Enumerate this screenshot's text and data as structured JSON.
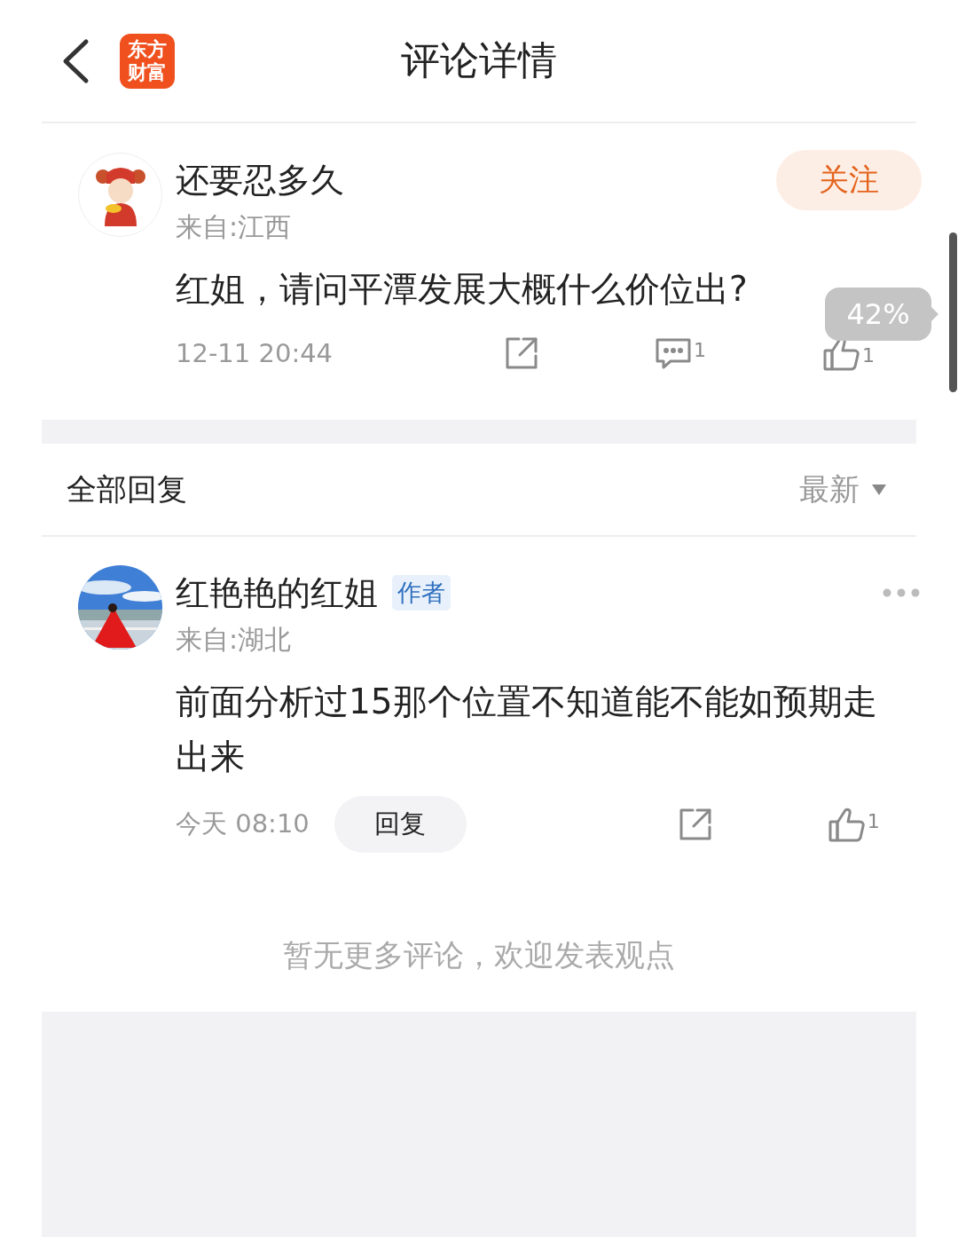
{
  "header": {
    "logo_text": "东方财富",
    "title": "评论详情"
  },
  "comment": {
    "author": "还要忍多久",
    "follow_label": "关注",
    "location": "来自:江西",
    "content": "红姐，请问平潭发展大概什么价位出?",
    "time": "12-11 20:44",
    "reply_count": "1",
    "like_count": "1"
  },
  "replies_header": {
    "title": "全部回复",
    "sort": "最新"
  },
  "replies": [
    {
      "author": "红艳艳的红姐",
      "badge": "作者",
      "location": "来自:湖北",
      "content": "前面分析过15那个位置不知道能不能如预期走出来",
      "time": "今天 08:10",
      "reply_label": "回复",
      "like_count": "1"
    }
  ],
  "footer_text": "暂无更多评论，欢迎发表观点",
  "scroll_bubble": "42%"
}
